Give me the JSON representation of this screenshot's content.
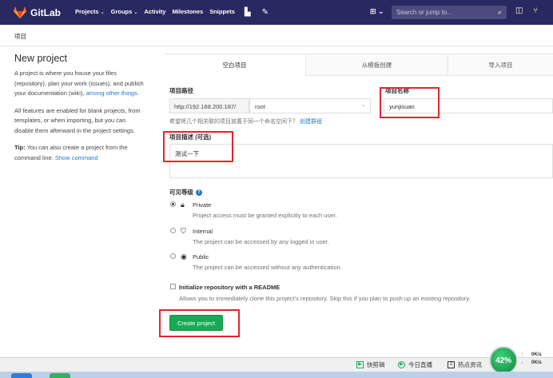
{
  "navbar": {
    "brand": "GitLab",
    "links": [
      {
        "label": "Projects",
        "dropdown": true
      },
      {
        "label": "Groups",
        "dropdown": true
      },
      {
        "label": "Activity",
        "dropdown": false
      },
      {
        "label": "Milestones",
        "dropdown": false
      },
      {
        "label": "Snippets",
        "dropdown": false
      }
    ],
    "search_placeholder": "Search or jump to...",
    "colors": {
      "bg": "#292961",
      "logo": "#fc6d26"
    }
  },
  "breadcrumb": "项目",
  "sidebar": {
    "title": "New project",
    "para1": "A project is where you house your files (repository), plan your work (issues), and publish your documentation (wiki),",
    "para1_link": "among other things.",
    "para2": "All features are enabled for blank projects, from templates, or when importing, but you can disable them afterward in the project settings.",
    "tip_label": "Tip:",
    "tip_text": "You can also create a project from the command line.",
    "tip_link": "Show command"
  },
  "tabs": [
    "空白项目",
    "从模板创建",
    "导入项目"
  ],
  "form": {
    "path_label": "项目路径",
    "url_prefix": "http://192.168.200.187/",
    "namespace": "root",
    "name_label": "项目名称",
    "name_value": "yunjisuan",
    "hint": "希望将几个相关联的项目放置于同一个命名空间下？",
    "hint_link": "创建群组",
    "desc_label": "项目描述 (可选)",
    "desc_value": "测试一下",
    "visibility_label": "可见等级",
    "visibility": [
      {
        "name": "Private",
        "desc": "Project access must be granted explicitly to each user.",
        "icon": "lock-icon",
        "selected": true
      },
      {
        "name": "Internal",
        "desc": "The project can be accessed by any logged in user.",
        "icon": "shield-icon",
        "selected": false
      },
      {
        "name": "Public",
        "desc": "The project can be accessed without any authentication.",
        "icon": "globe-icon",
        "selected": false
      }
    ],
    "readme_title": "Initialize repository with a README",
    "readme_desc": "Allows you to immediately clone this project's repository. Skip this if you plan to push up an existing repository.",
    "submit": "Create project",
    "submit_color": "#1aaa55"
  },
  "status_bar": {
    "items": [
      "快剪辑",
      "今日直播",
      "热点资讯"
    ],
    "gauge": "42%",
    "upload": "0K/s",
    "download": "0K/s"
  }
}
